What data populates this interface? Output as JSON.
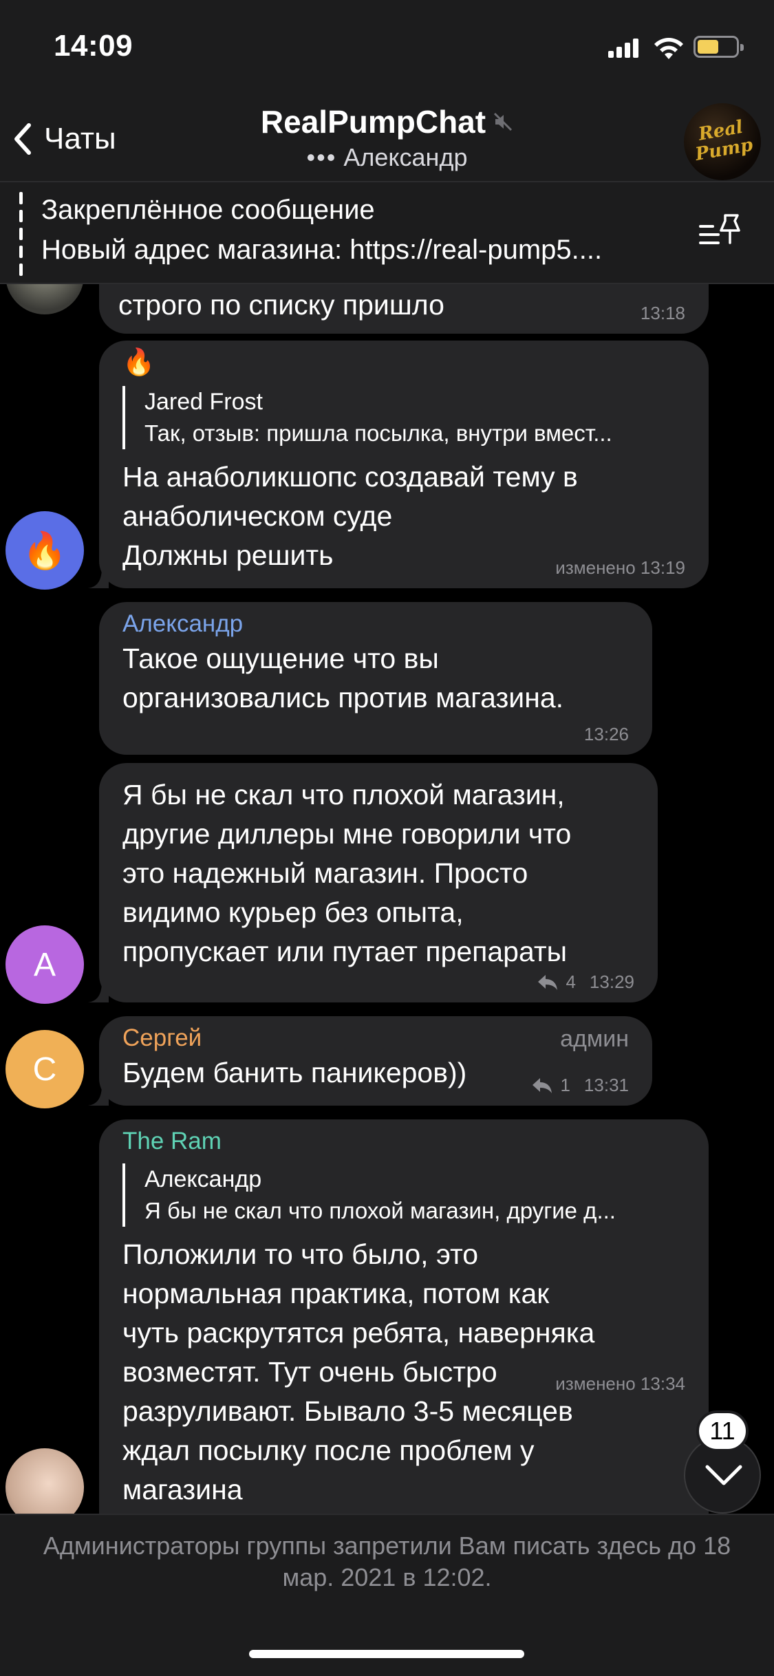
{
  "status_bar": {
    "time": "14:09"
  },
  "nav": {
    "back_label": "Чаты",
    "title": "RealPumpChat",
    "typing_dots": "•••",
    "typing_user": "Александр",
    "avatar_logo": "Real Pump"
  },
  "pinned": {
    "title": "Закреплённое сообщение",
    "text": "Новый адрес магазина: https://real-pump5...."
  },
  "messages": [
    {
      "text": "строго по списку  пришло",
      "time": "13:18"
    },
    {
      "emoji": "🔥",
      "reply_name": "Jared Frost",
      "reply_text": "Так, отзыв: пришла посылка, внутри вмест...",
      "text": "На анаболикшопс создавай тему в\nанаболическом суде\nДолжны решить",
      "time": "изменено 13:19",
      "avatar_emoji": "🔥"
    },
    {
      "sender": "Александр",
      "text": "Такое ощущение что вы\nорганизовались против магазина.",
      "time": "13:26"
    },
    {
      "text": "Я бы не скал что плохой магазин,\nдругие диллеры мне говорили что\nэто надежный магазин. Просто\nвидимо курьер без опыта,\nпропускает или путает препараты",
      "replies": "4",
      "time": "13:29",
      "avatar_letter": "А"
    },
    {
      "sender": "Сергей",
      "badge": "админ",
      "text": "Будем банить паникеров))",
      "replies": "1",
      "time": "13:31",
      "avatar_letter": "С"
    },
    {
      "sender": "The Ram",
      "reply_name": "Александр",
      "reply_text": "Я бы не скал что плохой магазин, другие д...",
      "text": "Положили то что было, это\nнормальная практика, потом как\nчуть раскрутятся ребята, наверняка\nвозместят. Тут очень быстро\nразруливают. Бывало 3-5 месяцев\nждал посылку после проблем у\nмагазина",
      "time": "изменено 13:34"
    }
  ],
  "scroll": {
    "unread": "11"
  },
  "restriction": "Администраторы группы запретили Вам писать здесь до 18 мар. 2021 в 12:02.",
  "colors": {
    "bubble": "#262628",
    "bar": "#1c1c1d",
    "alexandr": "#7ba4ea",
    "sergey": "#f0a35a",
    "the_ram": "#5fd3b5",
    "avatar_a": "#b867e0",
    "avatar_c": "#f0b056",
    "avatar_fire": "#5a6ee6"
  }
}
